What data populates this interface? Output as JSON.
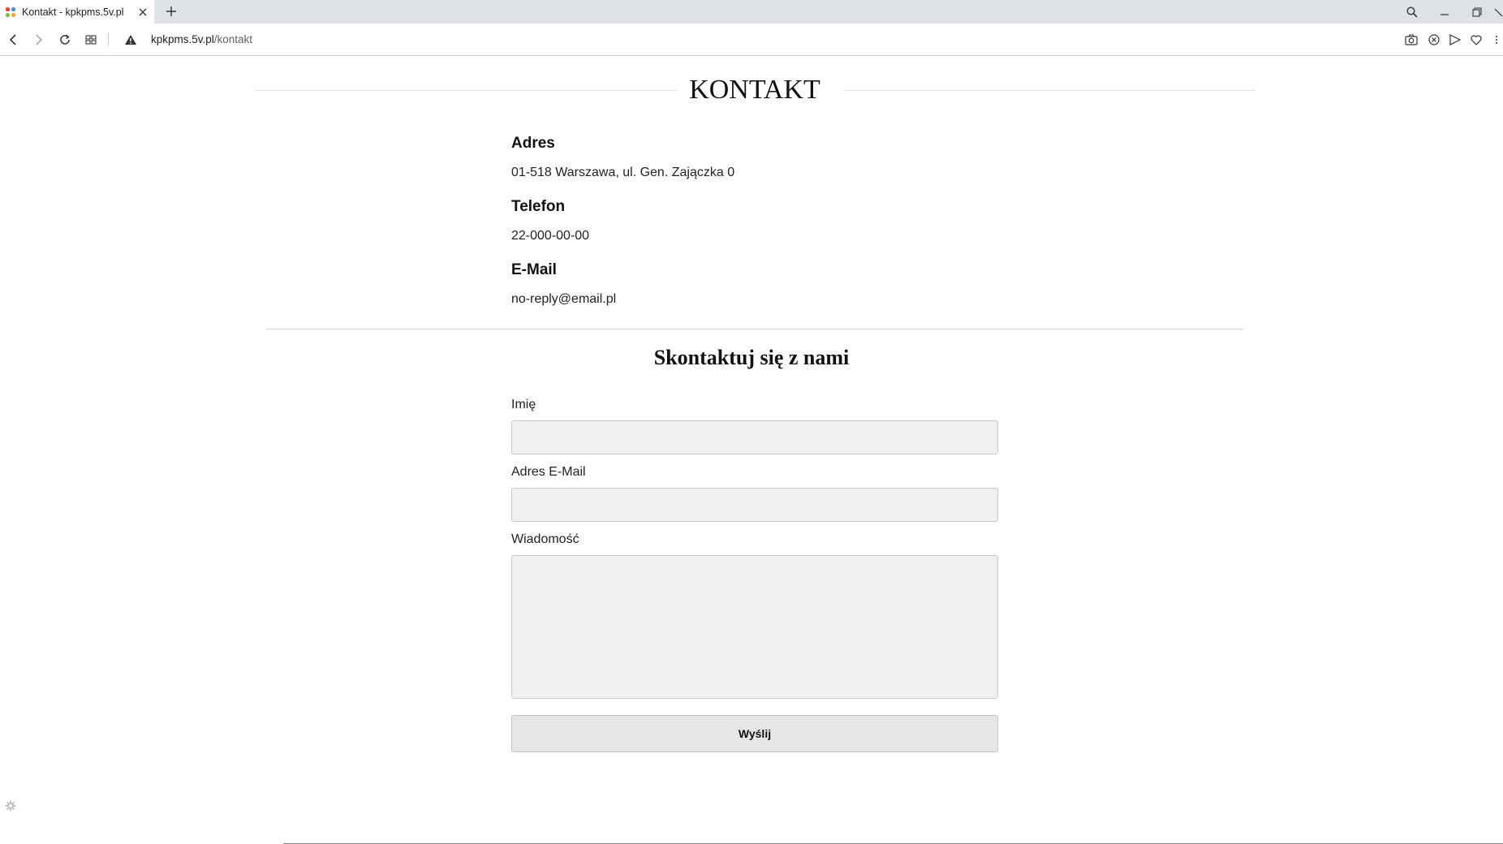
{
  "browser": {
    "tab_title": "Kontakt - kpkpms.5v.pl",
    "url_domain": "kpkpms.5v.pl",
    "url_path": "/kontakt"
  },
  "page": {
    "title": "KONTAKT",
    "address_heading": "Adres",
    "address_value": "01-518 Warszawa, ul. Gen. Zajączka 0",
    "phone_heading": "Telefon",
    "phone_value": "22-000-00-00",
    "email_heading": "E-Mail",
    "email_value": "no-reply@email.pl"
  },
  "form": {
    "title": "Skontaktuj się z nami",
    "name_label": "Imię",
    "email_label": "Adres E-Mail",
    "message_label": "Wiadomość",
    "name_value": "",
    "email_value": "",
    "message_value": "",
    "submit_label": "Wyślij"
  }
}
